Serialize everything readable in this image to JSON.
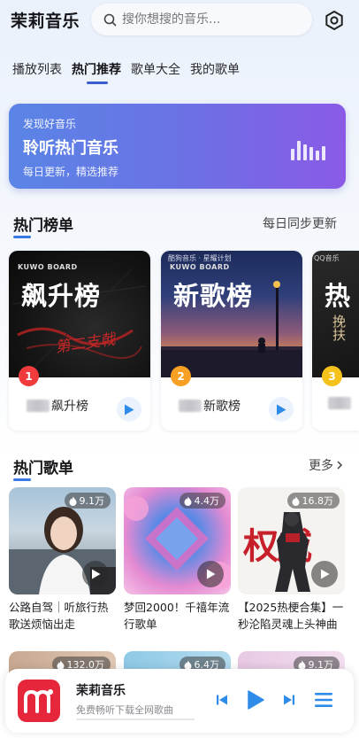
{
  "header": {
    "app_title": "茉莉音乐",
    "search_placeholder": "搜你想搜的音乐...",
    "settings_icon": "gear-hexagon-icon"
  },
  "tabs": [
    {
      "label": "播放列表",
      "active": false
    },
    {
      "label": "热门推荐",
      "active": true
    },
    {
      "label": "歌单大全",
      "active": false
    },
    {
      "label": "我的歌单",
      "active": false
    }
  ],
  "banner": {
    "subtitle": "发现好音乐",
    "title": "聆听热门音乐",
    "description": "每日更新，精选推荐",
    "icon": "equalizer-bars-icon"
  },
  "charts_section": {
    "title": "热门榜单",
    "right_text": "每日同步更新",
    "items": [
      {
        "rank": "1",
        "cover_brand": "KUWO BOARD",
        "cover_title": "飙升榜",
        "cover_decor": "第二支戟",
        "name": "飙升榜",
        "badge_color": "#ef3b3b"
      },
      {
        "rank": "2",
        "cover_brand": "KUWO BOARD",
        "cover_title": "新歌榜",
        "cover_decor": "酷狗音乐 · 星耀计划",
        "name": "新歌榜",
        "badge_color": "#f7a023"
      },
      {
        "rank": "3",
        "cover_brand": "QQ音乐",
        "cover_title": "热",
        "cover_decor": "挽扶",
        "name": "",
        "badge_color": "#f5c21c"
      }
    ]
  },
  "songs_section": {
    "title": "热门歌单",
    "more_label": "更多",
    "items": [
      {
        "count": "9.1万",
        "title": "公路自驾｜听旅行热歌送烦恼出走"
      },
      {
        "count": "4.4万",
        "title": "梦回2000！千禧年流行歌单"
      },
      {
        "count": "16.8万",
        "title": "【2025热梗合集】一秒沦陷灵魂上头神曲"
      },
      {
        "count": "132.0万",
        "title": ""
      },
      {
        "count": "6.4万",
        "title": ""
      },
      {
        "count": "9.1万",
        "title": ""
      }
    ],
    "cover3_text": "权威"
  },
  "player": {
    "title": "茉莉音乐",
    "subtitle": "免费畅听下载全网歌曲",
    "logo_letter": "m"
  },
  "colors": {
    "accent": "#3a78e6",
    "banner_start": "#5a85e6",
    "banner_end": "#8a5ae6",
    "player_logo": "#e5263b"
  }
}
